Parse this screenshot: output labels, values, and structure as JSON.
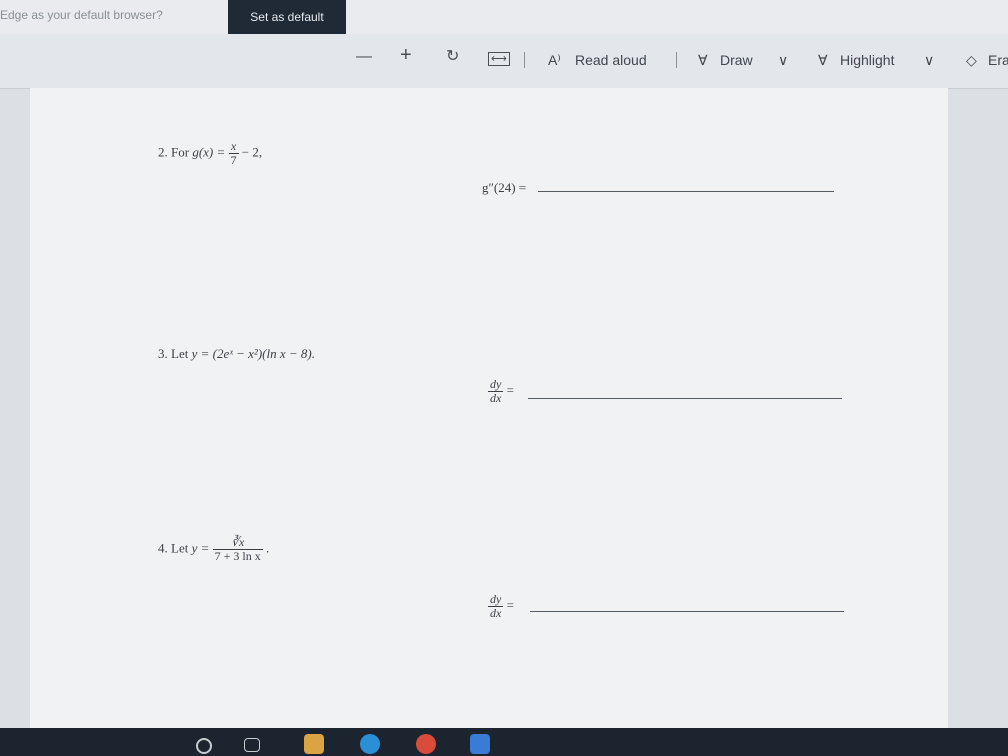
{
  "notification": {
    "message": "Edge as your default browser?",
    "button_label": "Set as default"
  },
  "toolbar": {
    "zoom_out": "—",
    "zoom_in": "+",
    "read_aloud": "Read aloud",
    "draw": "Draw",
    "highlight": "Highlight",
    "erase": "Era",
    "read_aloud_icon": "A⁾",
    "rotate_icon": "↻",
    "fit_icon": "⟷",
    "chevron": "∨"
  },
  "problems": {
    "p2": {
      "number": "2.",
      "lead": "For",
      "func": "g(x) =",
      "frac_num": "x",
      "frac_den": "7",
      "rest": "− 2,",
      "answer_label": "g″(24) ="
    },
    "p3": {
      "number": "3.",
      "lead": "Let",
      "expr": "y = (2eˣ − x²)(ln x − 8).",
      "answer_num": "dy",
      "answer_den": "dx",
      "answer_eq": "="
    },
    "p4": {
      "number": "4.",
      "lead": "Let",
      "lhs": "y =",
      "frac_num": "∛x",
      "frac_den": "7 + 3 ln x",
      "end": ".",
      "answer_num": "dy",
      "answer_den": "dx",
      "answer_eq": "="
    }
  }
}
